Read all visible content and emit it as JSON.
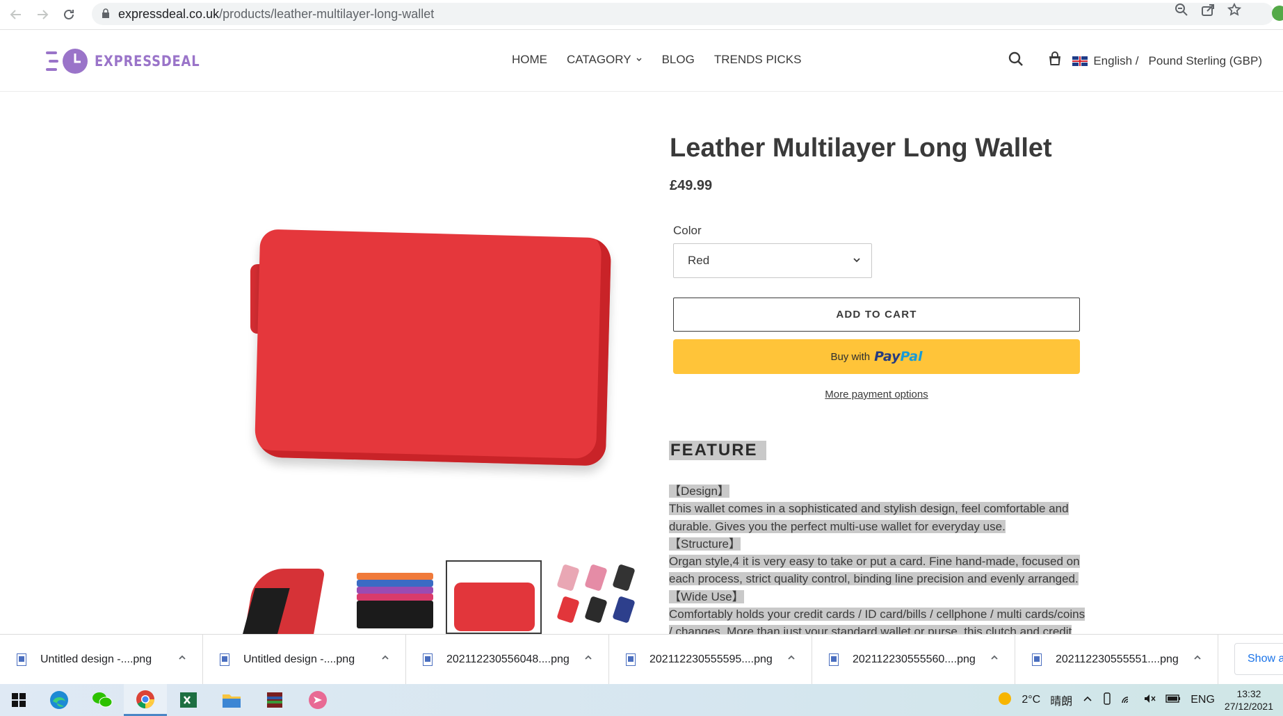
{
  "browser": {
    "url_host": "expressdeal.co.uk",
    "url_path": "/products/leather-multilayer-long-wallet"
  },
  "header": {
    "logo_text": "EXPRESSDEAL",
    "nav": [
      "HOME",
      "CATAGORY",
      "BLOG",
      "TRENDS PICKS"
    ],
    "language": "English /",
    "currency": "Pound Sterling (GBP)"
  },
  "product": {
    "title": "Leather Multilayer Long Wallet",
    "price": "£49.99",
    "color_label": "Color",
    "color_selected": "Red",
    "add_to_cart": "ADD TO CART",
    "paypal_prefix": "Buy with",
    "paypal_pay": "Pay",
    "paypal_pal": "Pal",
    "more_payment": "More payment options",
    "feature_title": "FEATURE",
    "description": [
      "【Design】",
      "This wallet comes in a sophisticated and stylish design, feel comfortable and",
      "durable. Gives you the perfect multi-use wallet for everyday use.",
      "【Structure】",
      "Organ style,4 it is very easy to take or put a card. Fine hand-made, focused on",
      "each process, strict quality control, binding line precision and evenly arranged.",
      "【Wide Use】",
      "Comfortably holds your credit cards / ID card/bills / cellphone / multi cards/coins",
      "/ changes. More than just your standard wallet or purse, this clutch and credit"
    ]
  },
  "downloads": [
    "Untitled design -....png",
    "Untitled design -....png",
    "202112230556048....png",
    "202112230555595....png",
    "202112230555560....png",
    "202112230555551....png"
  ],
  "downloads_show_all": "Show all",
  "taskbar": {
    "weather": "2°C",
    "weather_desc": "晴朗",
    "lang": "ENG",
    "time": "13:32",
    "date": "27/12/2021"
  }
}
